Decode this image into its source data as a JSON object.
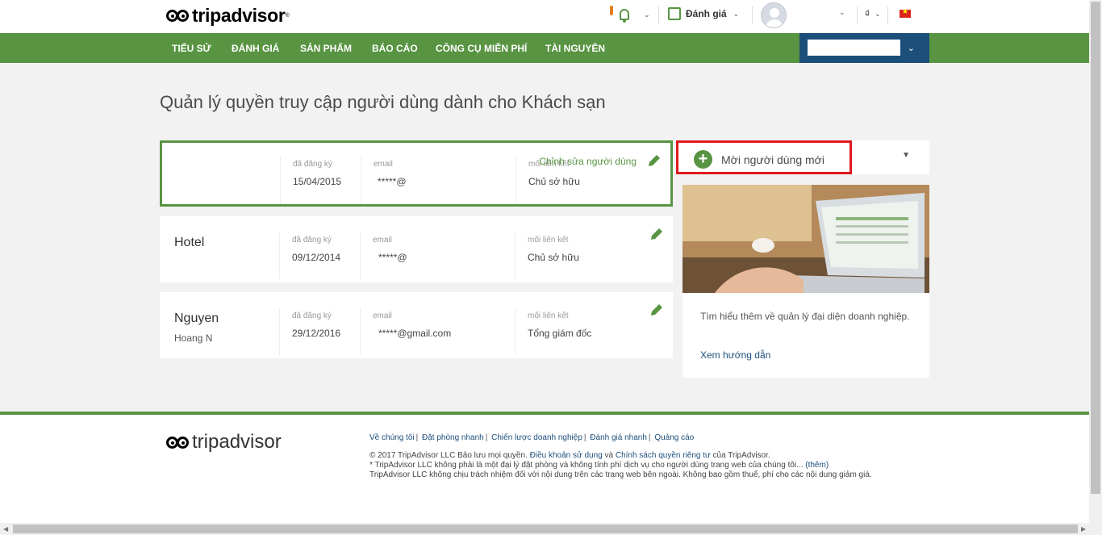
{
  "header": {
    "logo_text": "tripadvisor",
    "logo_reg": "®",
    "review_label": "Đánh giá",
    "currency": "₫",
    "caret": "⌄"
  },
  "nav": {
    "items": [
      "TIỂU SỬ",
      "ĐÁNH GIÁ",
      "SẢN PHẨM",
      "BÁO CÁO",
      "CÔNG CỤ MIỄN PHÍ",
      "TÀI NGUYÊN"
    ]
  },
  "page": {
    "title": "Quản lý quyền truy cập người dùng dành cho Khách sạn"
  },
  "labels": {
    "registered": "đã đăng ký",
    "email": "email",
    "relation": "mối liên kết"
  },
  "users": [
    {
      "name": "",
      "sub": "",
      "registered": "15/04/2015",
      "email": "*****@",
      "relation": "Chủ sở hữu",
      "edit_label": "Chỉnh sửa người dùng"
    },
    {
      "name": "Hotel",
      "sub": "",
      "registered": "09/12/2014",
      "email": "*****@",
      "relation": "Chủ sở hữu"
    },
    {
      "name": "Nguyen",
      "sub": "Hoang N",
      "registered": "29/12/2016",
      "email": "*****@gmail.com",
      "relation": "Tổng giám đốc"
    }
  ],
  "sidebar": {
    "new_user_label": "Mời người dùng mới",
    "promo_text": "Tìm hiểu thêm về quản lý đại diện doanh nghiệp.",
    "promo_link": "Xem hướng dẫn"
  },
  "footer": {
    "logo_text": "tripadvisor",
    "links": [
      "Về chúng tôi",
      "Đặt phòng nhanh",
      "Chiến lược doanh nghiệp",
      "Đánh giá nhanh",
      "Quảng cáo"
    ],
    "legal_prefix": "© 2017 TripAdvisor LLC Bảo lưu mọi quyền.",
    "terms_link": "Điều khoản sử dụng",
    "and_text": "và",
    "privacy_link": "Chính sách quyền riêng tư",
    "legal_suffix": "của TripAdvisor.",
    "disclaimer": "* TripAdvisor LLC không phải là một đại lý đặt phòng và không tính phí dịch vụ cho người dùng trang web của chúng tôi...",
    "more_link": "(thêm)",
    "disclaimer2": "TripAdvisor LLC không chịu trách nhiệm đối với nội dung trên các trang web bên ngoài. Không bao gồm thuế, phí cho các nội dung giảm giá."
  },
  "colors": {
    "green": "#589442",
    "navy": "#1c4e7a",
    "highlight_red": "#e0191d"
  }
}
